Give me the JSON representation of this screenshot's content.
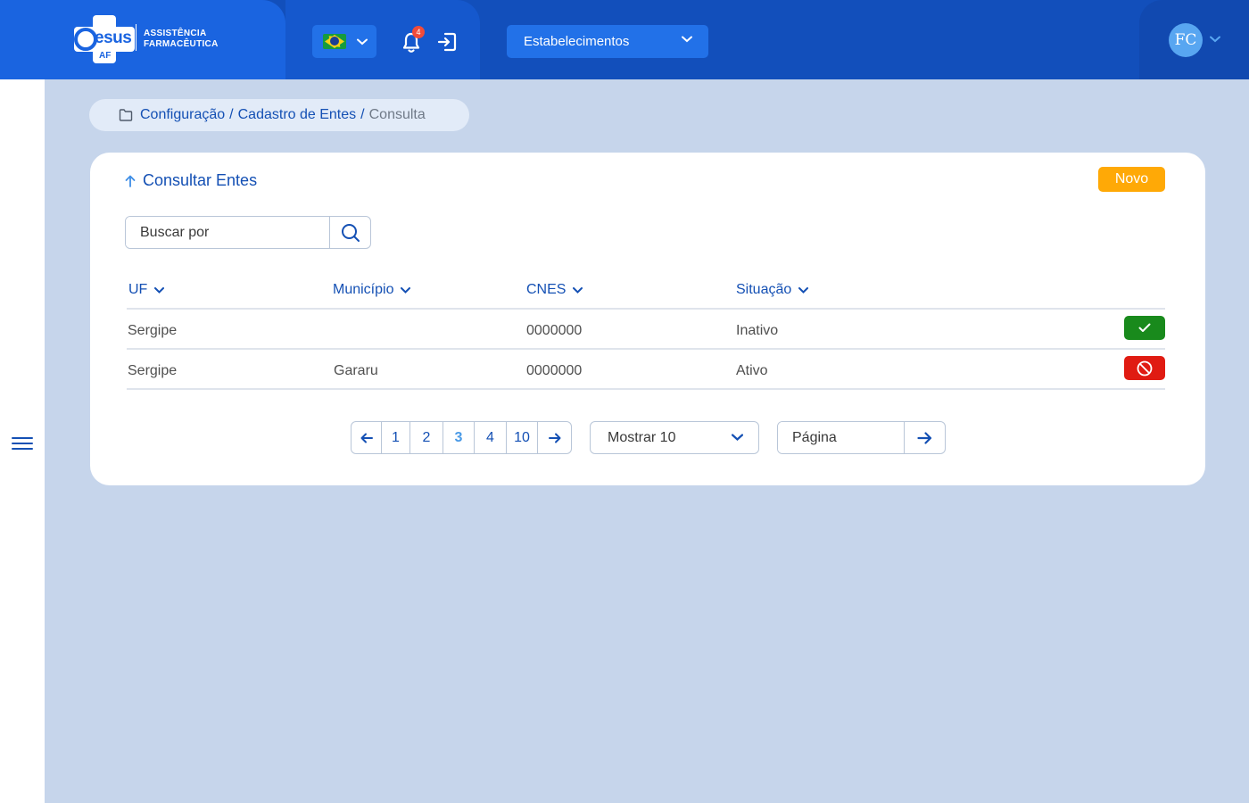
{
  "header": {
    "logo": {
      "brand": "esus",
      "sub": "AF",
      "line1": "ASSISTÊNCIA",
      "line2": "FARMACÊUTICA"
    },
    "notifications_count": "4",
    "establishments_label": "Estabelecimentos",
    "user_initials": "FC"
  },
  "breadcrumb": {
    "items": [
      "Configuração",
      "Cadastro de Entes"
    ],
    "current": "Consulta"
  },
  "card": {
    "title": "Consultar Entes",
    "new_button": "Novo",
    "search_placeholder": "Buscar por"
  },
  "table": {
    "columns": [
      "UF",
      "Município",
      "CNES",
      "Situação"
    ],
    "rows": [
      {
        "uf": "Sergipe",
        "municipio": "",
        "cnes": "0000000",
        "situacao": "Inativo",
        "action": "activate"
      },
      {
        "uf": "Sergipe",
        "municipio": "Gararu",
        "cnes": "0000000",
        "situacao": "Ativo",
        "action": "deactivate"
      }
    ]
  },
  "pagination": {
    "pages": [
      "1",
      "2",
      "3",
      "4",
      "10"
    ],
    "active_page": "3",
    "page_size_label": "Mostrar 10",
    "goto_placeholder": "Página"
  },
  "colors": {
    "primary": "#1450b4",
    "accent_orange": "#ffa906",
    "success": "#198a1c",
    "danger": "#e01b12"
  }
}
